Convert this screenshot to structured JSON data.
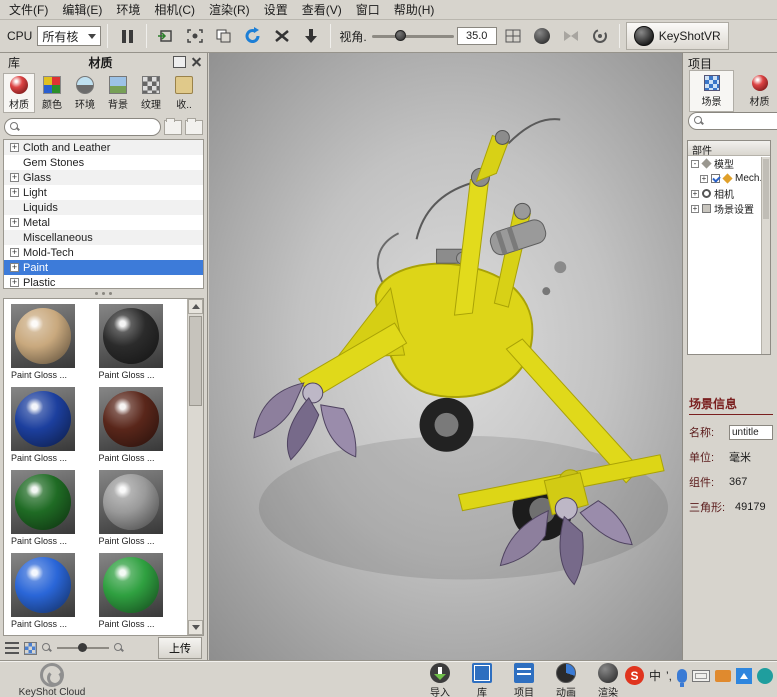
{
  "menubar": {
    "items": [
      {
        "label": "文件(F)"
      },
      {
        "label": "编辑(E)"
      },
      {
        "label": "环境"
      },
      {
        "label": "相机(C)"
      },
      {
        "label": "渲染(R)"
      },
      {
        "label": "设置"
      },
      {
        "label": "查看(V)"
      },
      {
        "label": "窗口"
      },
      {
        "label": "帮助(H)"
      }
    ]
  },
  "toolbar": {
    "cpu_label": "CPU",
    "cores_value": "所有核",
    "view_angle_label": "视角.",
    "view_angle_value": "35.0",
    "vr_label": "KeyShotVR"
  },
  "library": {
    "header_tab": "库",
    "header_title": "材质",
    "tabs": [
      {
        "label": "材质"
      },
      {
        "label": "颜色"
      },
      {
        "label": "环境"
      },
      {
        "label": "背景"
      },
      {
        "label": "纹理"
      },
      {
        "label": "收.."
      }
    ],
    "tree": [
      {
        "label": "Cloth and Leather"
      },
      {
        "label": "Gem Stones"
      },
      {
        "label": "Glass"
      },
      {
        "label": "Light"
      },
      {
        "label": "Liquids"
      },
      {
        "label": "Metal"
      },
      {
        "label": "Miscellaneous"
      },
      {
        "label": "Mold-Tech"
      },
      {
        "label": "Paint"
      },
      {
        "label": "Plastic"
      }
    ],
    "materials": [
      {
        "label": "Paint Gloss ...",
        "color": "#c9a97e"
      },
      {
        "label": "Paint Gloss ...",
        "color": "#2b2b2b"
      },
      {
        "label": "Paint Gloss ...",
        "color": "#1c3f9e"
      },
      {
        "label": "Paint Gloss ...",
        "color": "#59261a"
      },
      {
        "label": "Paint Gloss ...",
        "color": "#1f6b24"
      },
      {
        "label": "Paint Gloss ...",
        "color": "#9a9a9a"
      },
      {
        "label": "Paint Gloss ...",
        "color": "#2a66d8"
      },
      {
        "label": "Paint Gloss ...",
        "color": "#2fa040"
      }
    ],
    "upload_label": "上传"
  },
  "project": {
    "title": "项目",
    "tabs": [
      {
        "label": "场景"
      },
      {
        "label": "材质"
      }
    ],
    "parts_header": "部件",
    "tree": [
      {
        "label": "模型"
      },
      {
        "label": "Mech..."
      },
      {
        "label": "相机"
      },
      {
        "label": "场景设置"
      }
    ],
    "info": {
      "header": "场景信息",
      "name_label": "名称:",
      "name_value": "untitle",
      "unit_label": "单位:",
      "unit_value": "毫米",
      "parts_label": "组件:",
      "parts_value": "367",
      "tri_label": "三角形:",
      "tri_value": "49179"
    }
  },
  "bottom": {
    "cloud_label": "KeyShot Cloud",
    "items": [
      {
        "label": "导入"
      },
      {
        "label": "库"
      },
      {
        "label": "项目"
      },
      {
        "label": "动画"
      },
      {
        "label": "渲染"
      }
    ],
    "ime": {
      "logo": "S",
      "mode": "中",
      "punct": "’,"
    }
  }
}
